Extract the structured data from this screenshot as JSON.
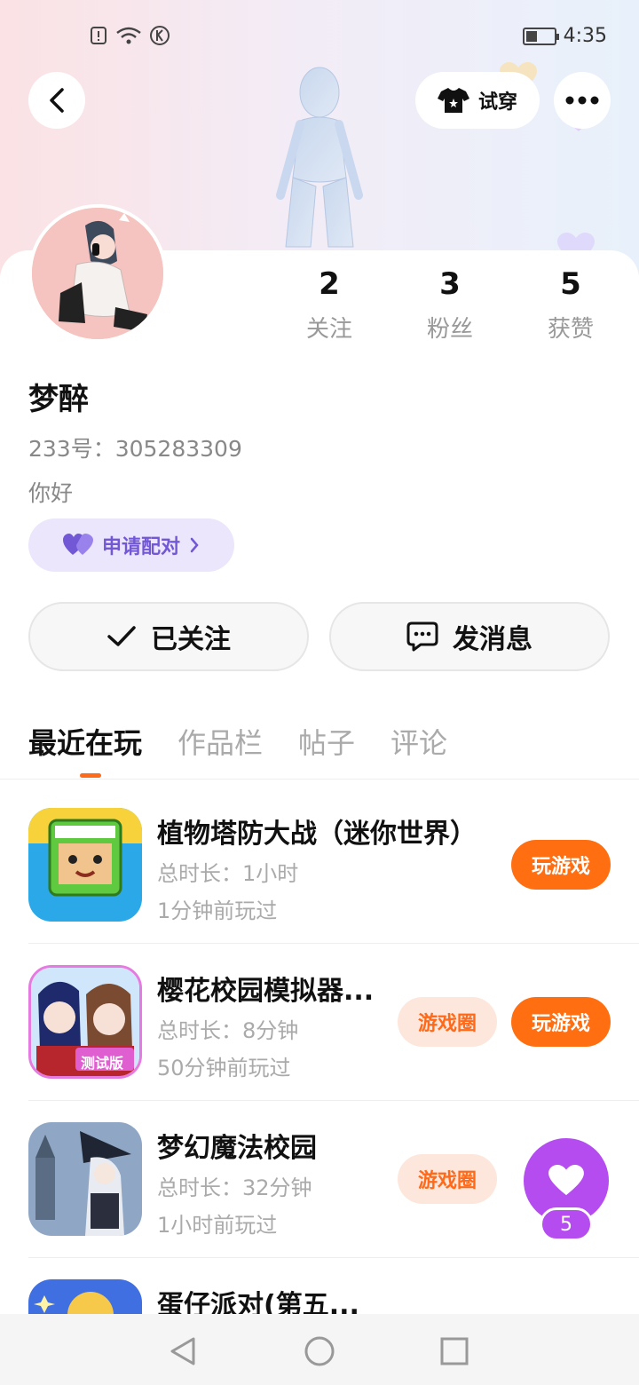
{
  "status_bar": {
    "time": "4:35",
    "icons": [
      "alert-icon",
      "wifi-icon",
      "k-icon",
      "battery-icon"
    ]
  },
  "header": {
    "back_icon": "chevron-left-icon",
    "try_on_label": "试穿",
    "more_icon": "more-dots-icon"
  },
  "profile": {
    "stats": [
      {
        "value": "2",
        "label": "关注"
      },
      {
        "value": "3",
        "label": "粉丝"
      },
      {
        "value": "5",
        "label": "获赞"
      }
    ],
    "username": "梦醉",
    "uid": "233号：305283309",
    "bio": "你好",
    "pair_label": "申请配对"
  },
  "actions": {
    "followed_label": "已关注",
    "message_label": "发消息"
  },
  "tabs": [
    "最近在玩",
    "作品栏",
    "帖子",
    "评论"
  ],
  "games": [
    {
      "name": "植物塔防大战（迷你世界）",
      "duration": "总时长：1小时",
      "last_played": "1分钟前玩过",
      "play_label": "玩游戏",
      "circle_label": ""
    },
    {
      "name": "樱花校园模拟器...",
      "duration": "总时长：8分钟",
      "last_played": "50分钟前玩过",
      "play_label": "玩游戏",
      "circle_label": "游戏圈",
      "icon_badge": "测试版"
    },
    {
      "name": "梦幻魔法校园",
      "duration": "总时长：32分钟",
      "last_played": "1小时前玩过",
      "play_label": "",
      "circle_label": "游戏圈"
    },
    {
      "name": "蛋仔派对(第五...",
      "duration": "",
      "last_played": "",
      "play_label": "",
      "circle_label": ""
    }
  ],
  "floating_like": {
    "count": "5"
  },
  "colors": {
    "accent_orange": "#ff6f12",
    "pair_purple": "#7358d6",
    "like_purple": "#b54cf0"
  }
}
